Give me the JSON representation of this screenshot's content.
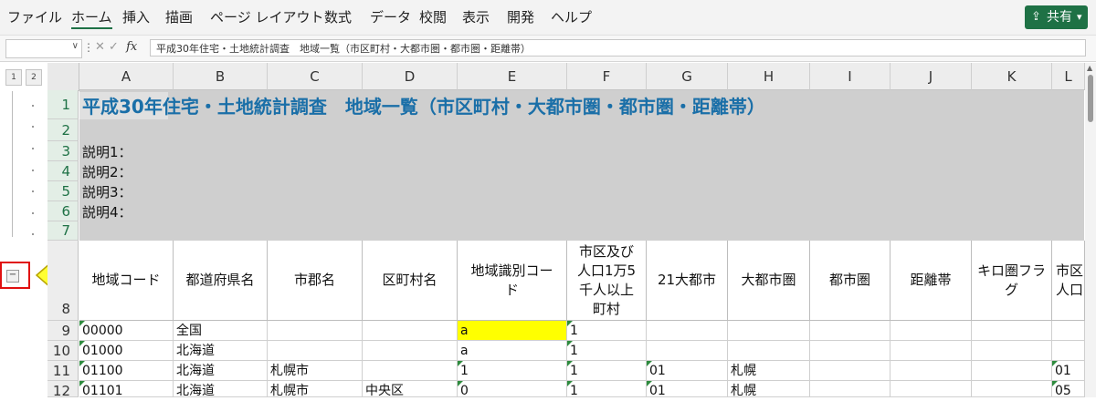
{
  "menu": [
    "ファイル",
    "ホーム",
    "挿入",
    "描画",
    "ページ レイアウト",
    "数式",
    "データ",
    "校閲",
    "表示",
    "開発",
    "ヘルプ"
  ],
  "share_label": "共有",
  "formula_bar": {
    "name_box": "",
    "fx": "fx",
    "cancel": "✕",
    "enter": "✓",
    "content": "平成30年住宅・土地統計調査　地域一覧（市区町村・大都市圏・都市圏・距離帯）"
  },
  "outline_levels": [
    "1",
    "2"
  ],
  "outline_collapse": "−",
  "columns": [
    "A",
    "B",
    "C",
    "D",
    "E",
    "F",
    "G",
    "H",
    "I",
    "J",
    "K",
    "L"
  ],
  "rows": [
    "1",
    "2",
    "3",
    "4",
    "5",
    "6",
    "7",
    "8",
    "9",
    "10",
    "11",
    "12"
  ],
  "title": "平成30年住宅・土地統計調査　地域一覧（市区町村・大都市圏・都市圏・距離帯）",
  "descriptions": [
    "説明1：",
    "説明2：",
    "説明3：",
    "説明4："
  ],
  "headers": [
    [
      "地域コード"
    ],
    [
      "都道府県名"
    ],
    [
      "市郡名"
    ],
    [
      "区町村名"
    ],
    [
      "地域識別コー",
      "ド"
    ],
    [
      "市区及び",
      "人口1万5",
      "千人以上",
      "町村"
    ],
    [
      "21大都市"
    ],
    [
      "大都市圏"
    ],
    [
      "都市圏"
    ],
    [
      "距離帯"
    ],
    [
      "キロ圏フラ",
      "グ"
    ],
    [
      "市区",
      "人口"
    ]
  ],
  "data_rows": [
    [
      "00000",
      "全国",
      "",
      "",
      "a",
      "1",
      "",
      "",
      "",
      "",
      "",
      ""
    ],
    [
      "01000",
      "北海道",
      "",
      "",
      "a",
      "1",
      "",
      "",
      "",
      "",
      "",
      ""
    ],
    [
      "01100",
      "北海道",
      "札幌市",
      "",
      "1",
      "1",
      "01",
      "札幌",
      "",
      "",
      "",
      "01"
    ],
    [
      "01101",
      "北海道",
      "札幌市",
      "中央区",
      "0",
      "1",
      "01",
      "札幌",
      "",
      "",
      "",
      "05"
    ]
  ],
  "colors": {
    "accent": "#1e7145",
    "title": "#1a6fa8",
    "highlight": "#ffff00",
    "annotation": "#e01010",
    "arrow_fill": "#ffff33"
  }
}
